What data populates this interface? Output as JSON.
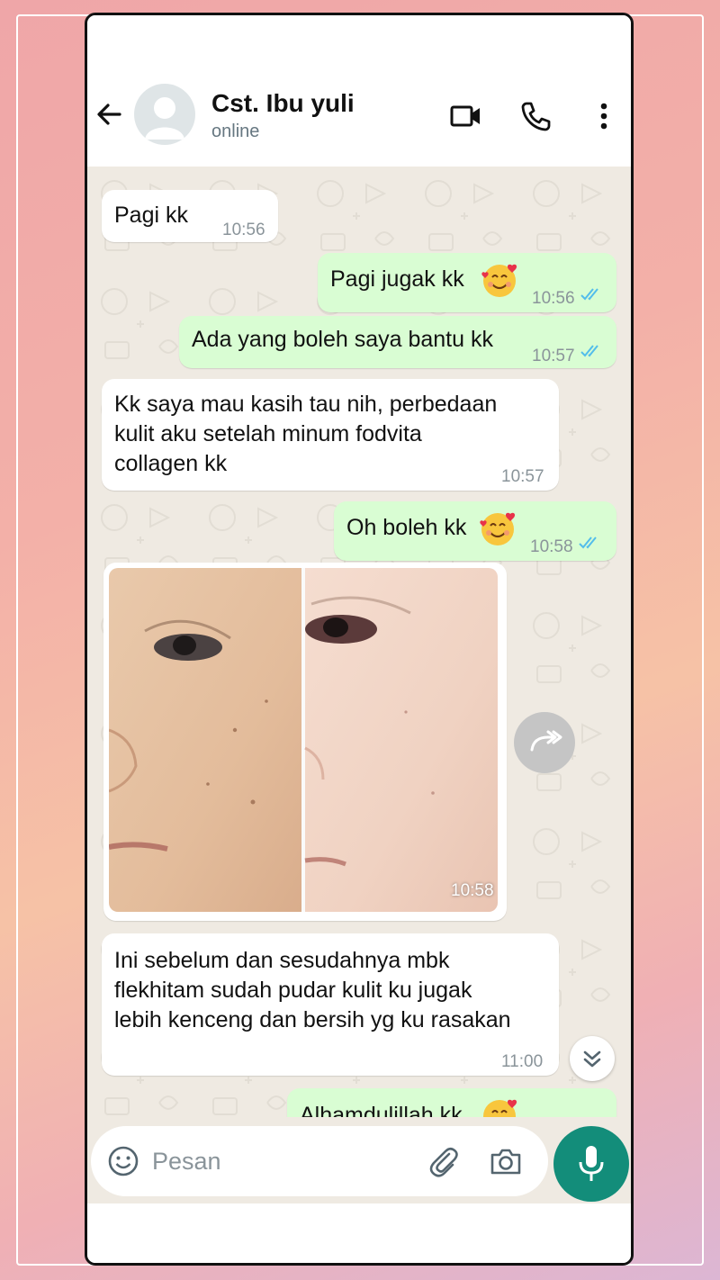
{
  "header": {
    "contact_name": "Cst. Ibu yuli",
    "status": "online"
  },
  "messages": [
    {
      "dir": "in",
      "text": "Pagi kk",
      "time": "10:56"
    },
    {
      "dir": "out",
      "text": "Pagi jugak kk",
      "time": "10:56",
      "emoji": "smiling-face-with-hearts"
    },
    {
      "dir": "out",
      "text": "Ada yang boleh saya bantu kk",
      "time": "10:57"
    },
    {
      "dir": "in",
      "lines": [
        "Kk saya mau kasih tau nih, perbedaan",
        "kulit aku setelah minum fodvita",
        "collagen kk"
      ],
      "time": "10:57"
    },
    {
      "dir": "out",
      "text": "Oh boleh kk",
      "time": "10:58",
      "emoji": "smiling-face-with-hearts"
    },
    {
      "dir": "in",
      "type": "photo",
      "time": "10:58"
    },
    {
      "dir": "in",
      "lines": [
        "Ini sebelum dan sesudahnya mbk",
        "flekhitam sudah pudar kulit ku jugak",
        "lebih kenceng dan bersih yg ku rasakan"
      ],
      "time": "11:00"
    },
    {
      "dir": "out",
      "text": "Alhamdulillah kk",
      "emoji": "smiling-face-with-hearts"
    }
  ],
  "input": {
    "placeholder": "Pesan"
  },
  "colors": {
    "outgoing_bubble": "#d9fdd3",
    "incoming_bubble": "#ffffff",
    "chat_background": "#efeae2",
    "read_ticks": "#53bdeb",
    "mic_button": "#138d7a"
  }
}
